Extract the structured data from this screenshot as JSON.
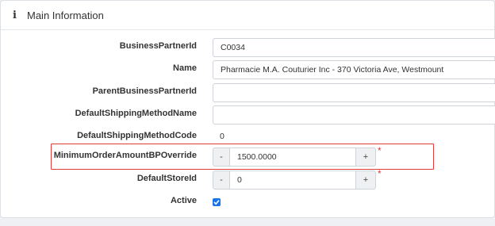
{
  "header": {
    "icon": "info-icon",
    "title": "Main Information"
  },
  "fields": {
    "business_partner_id": {
      "label": "BusinessPartnerId",
      "value": "C0034"
    },
    "name": {
      "label": "Name",
      "value": "Pharmacie M.A. Couturier Inc - 370 Victoria Ave, Westmount"
    },
    "parent_business_partner_id": {
      "label": "ParentBusinessPartnerId",
      "value": ""
    },
    "default_shipping_method_name": {
      "label": "DefaultShippingMethodName",
      "value": ""
    },
    "default_shipping_method_code": {
      "label": "DefaultShippingMethodCode",
      "value": "0"
    },
    "minimum_order_amount": {
      "label": "MinimumOrderAmountBPOverride",
      "value": "1500.0000",
      "minus": "-",
      "plus": "+",
      "required": "*"
    },
    "default_store_id": {
      "label": "DefaultStoreId",
      "value": "0",
      "minus": "-",
      "plus": "+",
      "required": "*"
    },
    "active": {
      "label": "Active",
      "checked": true
    }
  },
  "colors": {
    "accent": "#1a73e8",
    "highlight": "#e23b3b",
    "required": "#e23b3b"
  }
}
